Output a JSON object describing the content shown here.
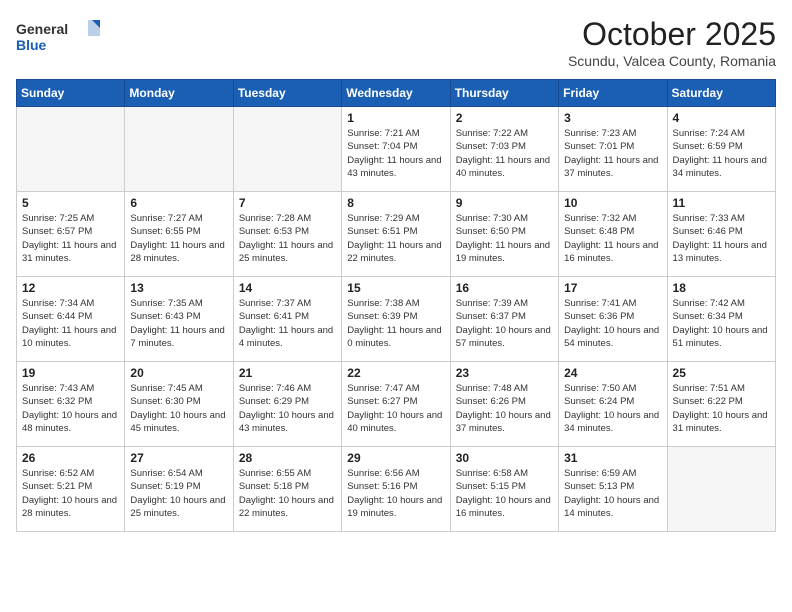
{
  "header": {
    "logo_general": "General",
    "logo_blue": "Blue",
    "month": "October 2025",
    "location": "Scundu, Valcea County, Romania"
  },
  "days_of_week": [
    "Sunday",
    "Monday",
    "Tuesday",
    "Wednesday",
    "Thursday",
    "Friday",
    "Saturday"
  ],
  "weeks": [
    [
      {
        "day": "",
        "info": ""
      },
      {
        "day": "",
        "info": ""
      },
      {
        "day": "",
        "info": ""
      },
      {
        "day": "1",
        "info": "Sunrise: 7:21 AM\nSunset: 7:04 PM\nDaylight: 11 hours\nand 43 minutes."
      },
      {
        "day": "2",
        "info": "Sunrise: 7:22 AM\nSunset: 7:03 PM\nDaylight: 11 hours\nand 40 minutes."
      },
      {
        "day": "3",
        "info": "Sunrise: 7:23 AM\nSunset: 7:01 PM\nDaylight: 11 hours\nand 37 minutes."
      },
      {
        "day": "4",
        "info": "Sunrise: 7:24 AM\nSunset: 6:59 PM\nDaylight: 11 hours\nand 34 minutes."
      }
    ],
    [
      {
        "day": "5",
        "info": "Sunrise: 7:25 AM\nSunset: 6:57 PM\nDaylight: 11 hours\nand 31 minutes."
      },
      {
        "day": "6",
        "info": "Sunrise: 7:27 AM\nSunset: 6:55 PM\nDaylight: 11 hours\nand 28 minutes."
      },
      {
        "day": "7",
        "info": "Sunrise: 7:28 AM\nSunset: 6:53 PM\nDaylight: 11 hours\nand 25 minutes."
      },
      {
        "day": "8",
        "info": "Sunrise: 7:29 AM\nSunset: 6:51 PM\nDaylight: 11 hours\nand 22 minutes."
      },
      {
        "day": "9",
        "info": "Sunrise: 7:30 AM\nSunset: 6:50 PM\nDaylight: 11 hours\nand 19 minutes."
      },
      {
        "day": "10",
        "info": "Sunrise: 7:32 AM\nSunset: 6:48 PM\nDaylight: 11 hours\nand 16 minutes."
      },
      {
        "day": "11",
        "info": "Sunrise: 7:33 AM\nSunset: 6:46 PM\nDaylight: 11 hours\nand 13 minutes."
      }
    ],
    [
      {
        "day": "12",
        "info": "Sunrise: 7:34 AM\nSunset: 6:44 PM\nDaylight: 11 hours\nand 10 minutes."
      },
      {
        "day": "13",
        "info": "Sunrise: 7:35 AM\nSunset: 6:43 PM\nDaylight: 11 hours\nand 7 minutes."
      },
      {
        "day": "14",
        "info": "Sunrise: 7:37 AM\nSunset: 6:41 PM\nDaylight: 11 hours\nand 4 minutes."
      },
      {
        "day": "15",
        "info": "Sunrise: 7:38 AM\nSunset: 6:39 PM\nDaylight: 11 hours\nand 0 minutes."
      },
      {
        "day": "16",
        "info": "Sunrise: 7:39 AM\nSunset: 6:37 PM\nDaylight: 10 hours\nand 57 minutes."
      },
      {
        "day": "17",
        "info": "Sunrise: 7:41 AM\nSunset: 6:36 PM\nDaylight: 10 hours\nand 54 minutes."
      },
      {
        "day": "18",
        "info": "Sunrise: 7:42 AM\nSunset: 6:34 PM\nDaylight: 10 hours\nand 51 minutes."
      }
    ],
    [
      {
        "day": "19",
        "info": "Sunrise: 7:43 AM\nSunset: 6:32 PM\nDaylight: 10 hours\nand 48 minutes."
      },
      {
        "day": "20",
        "info": "Sunrise: 7:45 AM\nSunset: 6:30 PM\nDaylight: 10 hours\nand 45 minutes."
      },
      {
        "day": "21",
        "info": "Sunrise: 7:46 AM\nSunset: 6:29 PM\nDaylight: 10 hours\nand 43 minutes."
      },
      {
        "day": "22",
        "info": "Sunrise: 7:47 AM\nSunset: 6:27 PM\nDaylight: 10 hours\nand 40 minutes."
      },
      {
        "day": "23",
        "info": "Sunrise: 7:48 AM\nSunset: 6:26 PM\nDaylight: 10 hours\nand 37 minutes."
      },
      {
        "day": "24",
        "info": "Sunrise: 7:50 AM\nSunset: 6:24 PM\nDaylight: 10 hours\nand 34 minutes."
      },
      {
        "day": "25",
        "info": "Sunrise: 7:51 AM\nSunset: 6:22 PM\nDaylight: 10 hours\nand 31 minutes."
      }
    ],
    [
      {
        "day": "26",
        "info": "Sunrise: 6:52 AM\nSunset: 5:21 PM\nDaylight: 10 hours\nand 28 minutes."
      },
      {
        "day": "27",
        "info": "Sunrise: 6:54 AM\nSunset: 5:19 PM\nDaylight: 10 hours\nand 25 minutes."
      },
      {
        "day": "28",
        "info": "Sunrise: 6:55 AM\nSunset: 5:18 PM\nDaylight: 10 hours\nand 22 minutes."
      },
      {
        "day": "29",
        "info": "Sunrise: 6:56 AM\nSunset: 5:16 PM\nDaylight: 10 hours\nand 19 minutes."
      },
      {
        "day": "30",
        "info": "Sunrise: 6:58 AM\nSunset: 5:15 PM\nDaylight: 10 hours\nand 16 minutes."
      },
      {
        "day": "31",
        "info": "Sunrise: 6:59 AM\nSunset: 5:13 PM\nDaylight: 10 hours\nand 14 minutes."
      },
      {
        "day": "",
        "info": ""
      }
    ]
  ]
}
